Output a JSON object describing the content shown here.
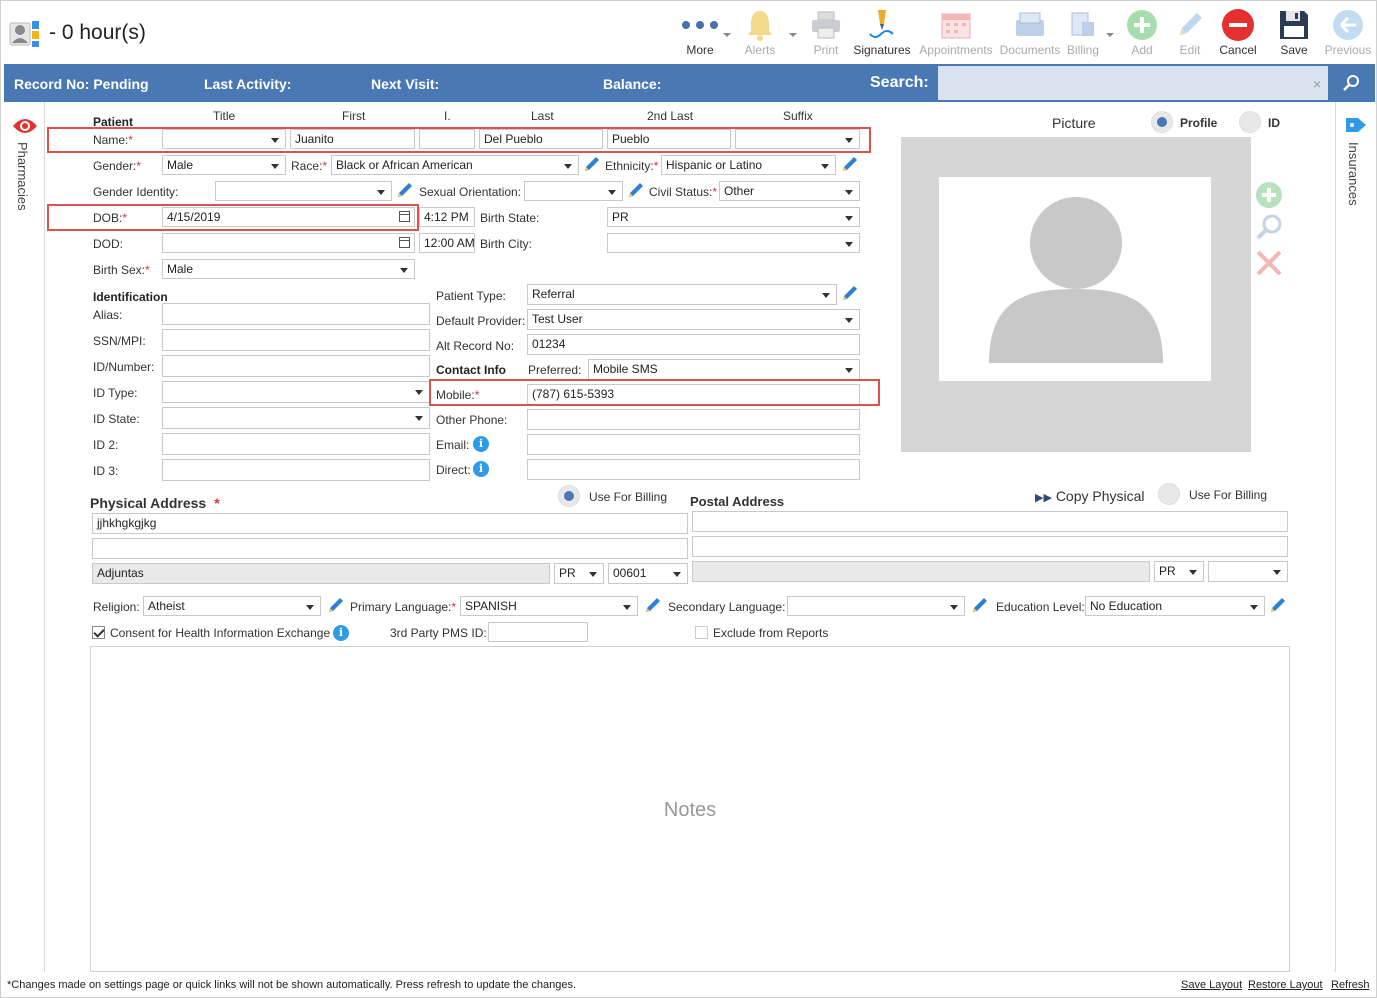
{
  "window": {
    "title": "- 0 hour(s)"
  },
  "toolbar": {
    "more": "More",
    "alerts": "Alerts",
    "print": "Print",
    "signatures": "Signatures",
    "appointments": "Appointments",
    "documents": "Documents",
    "billing": "Billing",
    "add": "Add",
    "edit": "Edit",
    "cancel": "Cancel",
    "save": "Save",
    "previous": "Previous"
  },
  "infobar": {
    "record_no": "Record No: Pending",
    "last_activity": "Last Activity:",
    "next_visit": "Next Visit:",
    "balance": "Balance:",
    "search_label": "Search:",
    "search_value": "",
    "clear": "×"
  },
  "side": {
    "left": "Pharmacies",
    "right": "Insurances"
  },
  "patient": {
    "section": "Patient",
    "col_title": "Title",
    "col_first": "First",
    "col_middle": "I.",
    "col_last": "Last",
    "col_2nd_last": "2nd Last",
    "col_suffix": "Suffix",
    "name_label": "Name:",
    "title": "",
    "first": "Juanito",
    "middle": "",
    "last": "Del Pueblo",
    "second_last": "Pueblo",
    "suffix": "",
    "gender_label": "Gender:",
    "gender": "Male",
    "race_label": "Race:",
    "race": "Black or African American",
    "ethnicity_label": "Ethnicity:",
    "ethnicity": "Hispanic or Latino",
    "gender_identity_label": "Gender Identity:",
    "gender_identity": "",
    "sexual_orientation_label": "Sexual Orientation:",
    "sexual_orientation": "",
    "civil_status_label": "Civil Status:",
    "civil_status": "Other",
    "dob_label": "DOB:",
    "dob": "4/15/2019",
    "dob_time": "4:12 PM",
    "birth_state_label": "Birth State:",
    "birth_state": "PR",
    "dod_label": "DOD:",
    "dod": "",
    "dod_time": "12:00 AM",
    "birth_city_label": "Birth City:",
    "birth_city": "",
    "birth_sex_label": "Birth Sex:",
    "birth_sex": "Male"
  },
  "identification": {
    "section": "Identification",
    "alias_label": "Alias:",
    "alias": "",
    "ssn_label": "SSN/MPI:",
    "ssn": "",
    "id_number_label": "ID/Number:",
    "id_number": "",
    "id_type_label": "ID Type:",
    "id_type": "",
    "id_state_label": "ID State:",
    "id_state": "",
    "id2_label": "ID 2:",
    "id2": "",
    "id3_label": "ID 3:",
    "id3": ""
  },
  "details": {
    "patient_type_label": "Patient Type:",
    "patient_type": "Referral",
    "default_provider_label": "Default Provider:",
    "default_provider": "Test User",
    "alt_record_label": "Alt Record No:",
    "alt_record": "01234"
  },
  "contact": {
    "section": "Contact Info",
    "preferred_label": "Preferred:",
    "preferred": "Mobile SMS",
    "mobile_label": "Mobile:",
    "mobile": "(787) 615-5393",
    "other_phone_label": "Other Phone:",
    "other_phone": "",
    "email_label": "Email:",
    "email": "",
    "direct_label": "Direct:",
    "direct": "",
    "info_glyph": "i"
  },
  "picture": {
    "label": "Picture",
    "profile": "Profile",
    "id": "ID"
  },
  "physical_address": {
    "title": "Physical Address",
    "use_for_billing": "Use For Billing",
    "line1": "jjhkhgkgjkg",
    "line2": "",
    "city": "Adjuntas",
    "state": "PR",
    "zip": "00601"
  },
  "postal_address": {
    "title": "Postal Address",
    "copy_physical": "Copy Physical",
    "use_for_billing": "Use For Billing",
    "line1": "",
    "line2": "",
    "city": "",
    "state": "PR",
    "zip": ""
  },
  "misc": {
    "religion_label": "Religion:",
    "religion": "Atheist",
    "primary_language_label": "Primary Language:",
    "primary_language": "SPANISH",
    "secondary_language_label": "Secondary Language:",
    "secondary_language": "",
    "education_level_label": "Education Level:",
    "education_level": "No Education",
    "consent_label": "Consent for Health Information Exchange",
    "third_party_label": "3rd Party PMS ID:",
    "third_party": "",
    "exclude_label": "Exclude from Reports"
  },
  "notes": {
    "label": "Notes"
  },
  "footer": {
    "note": "*Changes made on settings page or quick links will not be shown automatically. Press refresh to update the changes.",
    "save_layout": "Save Layout",
    "restore_layout": "Restore Layout",
    "refresh": "Refresh"
  },
  "colors": {
    "accent": "#4a78b4",
    "highlight": "#d9534f",
    "required": "#e03030",
    "info": "#2d9be8",
    "cancel": "#e03030",
    "add": "#5cbf6a"
  }
}
